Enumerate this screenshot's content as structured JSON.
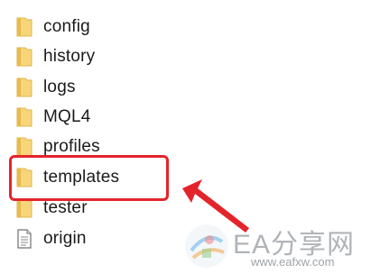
{
  "explorer": {
    "items": [
      {
        "name": "config",
        "type": "folder"
      },
      {
        "name": "history",
        "type": "folder"
      },
      {
        "name": "logs",
        "type": "folder"
      },
      {
        "name": "MQL4",
        "type": "folder"
      },
      {
        "name": "profiles",
        "type": "folder"
      },
      {
        "name": "templates",
        "type": "folder",
        "highlighted": true
      },
      {
        "name": "tester",
        "type": "folder"
      },
      {
        "name": "origin",
        "type": "file"
      }
    ]
  },
  "annotation": {
    "color": "#e3242b"
  },
  "watermark": {
    "title": "EA分享网",
    "url": "www.eafxw.com"
  },
  "colors": {
    "folder_fill": "#f7d67a",
    "folder_tab": "#e9b94a",
    "text": "#1a1a1a"
  }
}
